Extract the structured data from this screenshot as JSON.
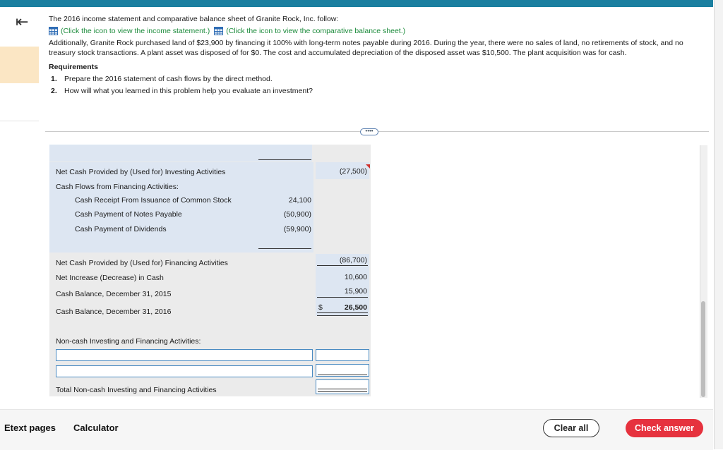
{
  "problem": {
    "intro": "The 2016 income statement and comparative balance sheet of Granite Rock, Inc. follow:",
    "link_income": "(Click the icon to view the income statement.)",
    "link_balance": "(Click the icon to view the comparative balance sheet.)",
    "additional": "Additionally, Granite Rock purchased land of $23,900 by financing it 100% with long-term notes payable during 2016. During the year, there were no sales of land, no retirements of stock, and no treasury stock transactions. A plant asset was disposed of for $0. The cost and accumulated depreciation of the disposed asset was $10,500. The plant acquisition was for cash.",
    "requirements_title": "Requirements",
    "requirements": [
      {
        "num": "1.",
        "text": "Prepare the 2016 statement of cash flows by the direct method."
      },
      {
        "num": "2.",
        "text": "How will what you learned in this problem help you evaluate an investment?"
      }
    ]
  },
  "more_button": "••••",
  "statement": {
    "investing_label": "Net Cash Provided by (Used for) Investing Activities",
    "investing_total": "(27,500)",
    "financing_header": "Cash Flows from Financing Activities:",
    "financing_items": [
      {
        "label": "Cash Receipt From Issuance of Common Stock",
        "amount": "24,100"
      },
      {
        "label": "Cash Payment of Notes Payable",
        "amount": "(50,900)"
      },
      {
        "label": "Cash Payment of Dividends",
        "amount": "(59,900)"
      }
    ],
    "financing_label": "Net Cash Provided by (Used for) Financing Activities",
    "financing_total": "(86,700)",
    "net_increase_label": "Net Increase (Decrease) in Cash",
    "net_increase": "10,600",
    "balance_2015_label": "Cash Balance, December 31, 2015",
    "balance_2015": "15,900",
    "balance_2016_label": "Cash Balance, December 31, 2016",
    "currency": "$",
    "balance_2016": "26,500",
    "noncash_header": "Non-cash Investing and Financing Activities:",
    "noncash_total_label": "Total Non-cash Investing and Financing Activities"
  },
  "footer": {
    "etext": "Etext pages",
    "calculator": "Calculator",
    "clear": "Clear all",
    "check": "Check answer"
  },
  "colors": {
    "accent_bar": "#1a7fa0",
    "link_green": "#1a8a3a",
    "check_red": "#e6323e",
    "input_blue": "#4a8bc2"
  }
}
